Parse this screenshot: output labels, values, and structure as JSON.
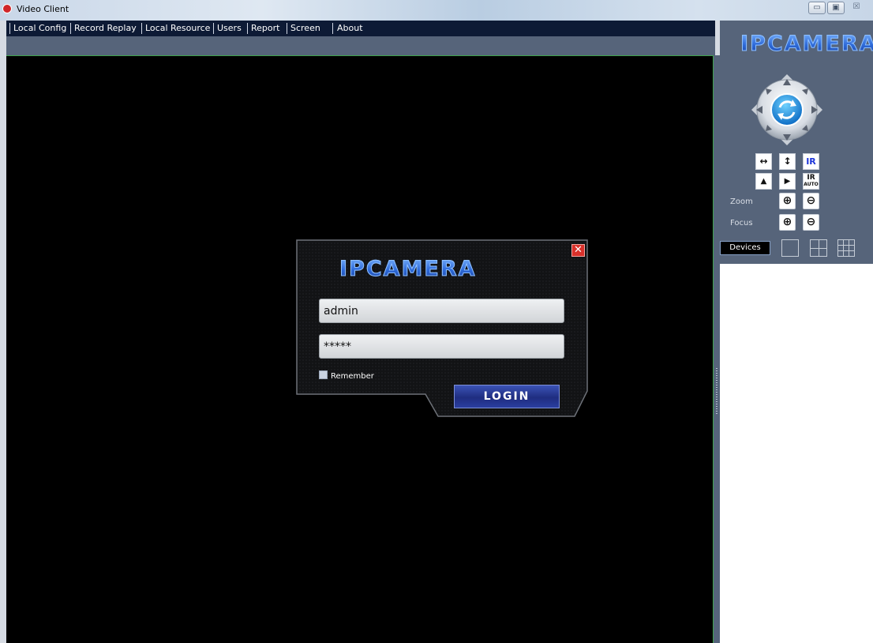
{
  "window": {
    "title": "Video Client",
    "buttons": {
      "minimize": "▭",
      "maximize": "▣",
      "close": "☒"
    }
  },
  "menu": {
    "items": [
      {
        "label": "Local Config"
      },
      {
        "label": "Record Replay"
      },
      {
        "label": "Local Resource"
      },
      {
        "label": "Users"
      },
      {
        "label": "Report"
      },
      {
        "label": "Screen"
      },
      {
        "label": "About"
      }
    ]
  },
  "brand": {
    "name": "IPCAMERA"
  },
  "login": {
    "username_value": "admin",
    "password_value": "*****",
    "remember_label": "Remember",
    "login_label": "LOGIN",
    "close_glyph": "✕"
  },
  "ptz_panel": {
    "flip_h_glyph": "↔",
    "flip_v_glyph": "↕",
    "ir_label": "IR",
    "ir_auto_label_top": "IR",
    "ir_auto_label_bottom": "AUTO",
    "mirror_glyph": "▲",
    "play_glyph": "▶",
    "zoom_label": "Zoom",
    "focus_label": "Focus",
    "plus_glyph": "⊕",
    "minus_glyph": "⊖",
    "devices_tab": "Devices"
  },
  "colors": {
    "menu_bg": "#0d1a35",
    "panel_bg": "#56647a",
    "video_bg": "#000000",
    "brand_blue": "#2d69d8",
    "login_btn": "#1f2d80",
    "close_red": "#d9312b"
  }
}
